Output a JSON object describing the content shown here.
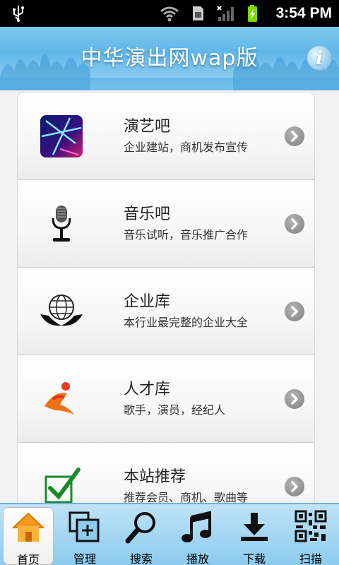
{
  "status_bar": {
    "time": "3:54 PM",
    "icons": [
      "usb-icon",
      "wifi-icon",
      "sim-icon",
      "signal-icon",
      "battery-charging-icon"
    ]
  },
  "header": {
    "title": "中华演出网wap版",
    "info_icon": "info-icon",
    "info_glyph": "i"
  },
  "list": {
    "items": [
      {
        "title": "演艺吧",
        "subtitle": "企业建站，商机发布宣传",
        "icon": "stage-lights-icon"
      },
      {
        "title": "音乐吧",
        "subtitle": "音乐试听，音乐推广合作",
        "icon": "microphone-icon"
      },
      {
        "title": "企业库",
        "subtitle": "本行业最完整的企业大全",
        "icon": "globe-hands-icon"
      },
      {
        "title": "人才库",
        "subtitle": "歌手，演员，经纪人",
        "icon": "running-person-icon"
      },
      {
        "title": "本站推荐",
        "subtitle": "推荐会员、商机、歌曲等",
        "icon": "checkbox-icon"
      }
    ],
    "chevron_icon": "chevron-right-icon"
  },
  "tabbar": {
    "active": "首页",
    "tabs": [
      {
        "label": "首页",
        "icon": "home-icon"
      },
      {
        "label": "管理",
        "icon": "manage-icon"
      },
      {
        "label": "搜索",
        "icon": "search-icon"
      },
      {
        "label": "播放",
        "icon": "music-note-icon"
      },
      {
        "label": "下载",
        "icon": "download-icon"
      },
      {
        "label": "扫描",
        "icon": "qr-code-icon"
      }
    ]
  },
  "colors": {
    "header_blue": "#5fb6e8",
    "tabbar_blue": "#8ccbef",
    "chevron_gray": "#8f8f8f",
    "checkbox_green": "#1a8a2a"
  }
}
